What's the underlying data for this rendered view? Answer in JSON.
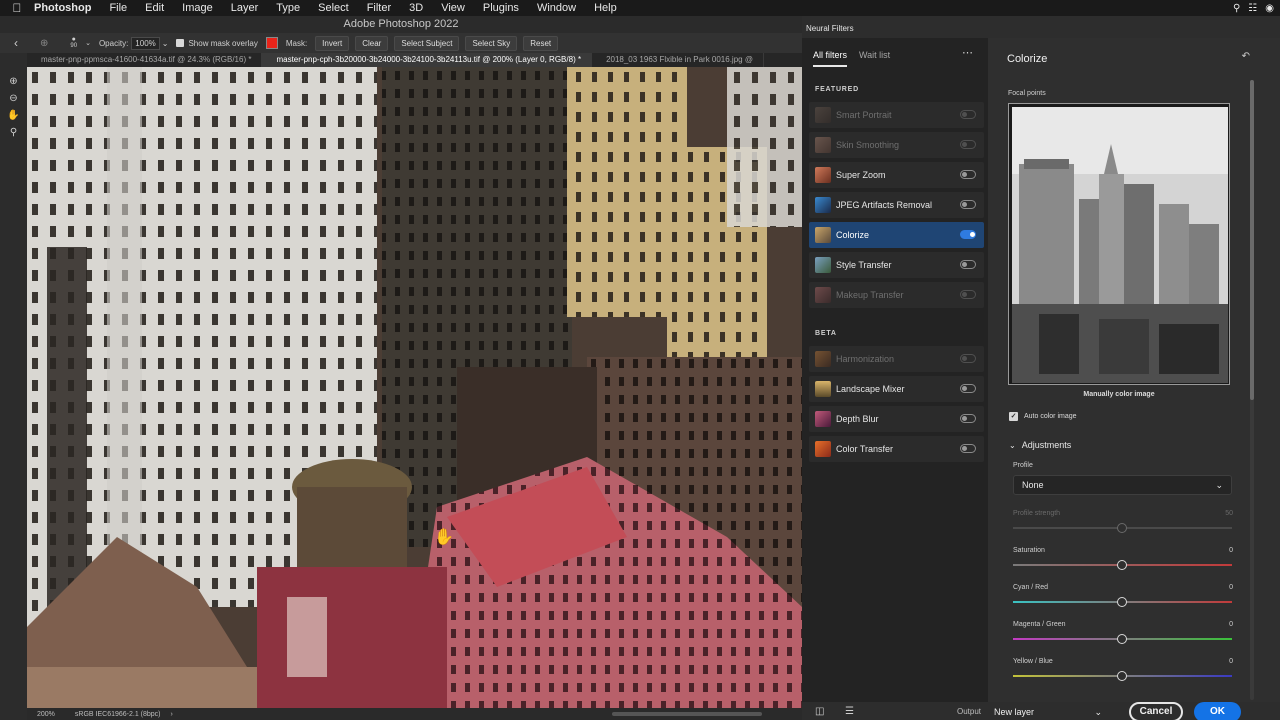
{
  "menubar": {
    "app": "Photoshop",
    "items": [
      "File",
      "Edit",
      "Image",
      "Layer",
      "Type",
      "Select",
      "Filter",
      "3D",
      "View",
      "Plugins",
      "Window",
      "Help"
    ]
  },
  "window": {
    "title": "Adobe Photoshop 2022"
  },
  "options_bar": {
    "brush_size": "90",
    "opacity_label": "Opacity:",
    "opacity_value": "100%",
    "show_mask_overlay": "Show mask overlay",
    "mask_label": "Mask:",
    "buttons": [
      "Invert",
      "Clear",
      "Select Subject",
      "Select Sky",
      "Reset"
    ],
    "mask_color": "#e8241a"
  },
  "doc_tabs": [
    "master-pnp-ppmsca-41600-41634a.tif @ 24.3% (RGB/16) *",
    "master-pnp-cph-3b20000-3b24000-3b24100-3b24113u.tif @ 200% (Layer 0, RGB/8) *",
    "2018_03 1963 Flxible in Park 0016.jpg @"
  ],
  "status_bar": {
    "zoom": "200%",
    "profile": "sRGB IEC61966-2.1 (8bpc)"
  },
  "neural_filters": {
    "panel_title": "Neural Filters",
    "tabs": [
      "All filters",
      "Wait list"
    ],
    "sections": [
      {
        "title": "FEATURED",
        "items": [
          {
            "label": "Smart Portrait",
            "enabled": false,
            "dim": true
          },
          {
            "label": "Skin Smoothing",
            "enabled": false,
            "dim": true
          },
          {
            "label": "Super Zoom",
            "enabled": false,
            "dim": false
          },
          {
            "label": "JPEG Artifacts Removal",
            "enabled": false,
            "dim": false
          },
          {
            "label": "Colorize",
            "enabled": true,
            "dim": false,
            "selected": true
          },
          {
            "label": "Style Transfer",
            "enabled": false,
            "dim": false
          },
          {
            "label": "Makeup Transfer",
            "enabled": false,
            "dim": true
          }
        ]
      },
      {
        "title": "BETA",
        "items": [
          {
            "label": "Harmonization",
            "enabled": false,
            "dim": true
          },
          {
            "label": "Landscape Mixer",
            "enabled": false,
            "dim": false
          },
          {
            "label": "Depth Blur",
            "enabled": false,
            "dim": false
          },
          {
            "label": "Color Transfer",
            "enabled": false,
            "dim": false
          }
        ]
      }
    ],
    "settings": {
      "title": "Colorize",
      "focal_points_label": "Focal points",
      "preview_caption": "Manually color image",
      "auto_color_label": "Auto color image",
      "adjustments_label": "Adjustments",
      "profile_label": "Profile",
      "profile_value": "None",
      "params": [
        {
          "label": "Profile strength",
          "value": "50",
          "dim": true
        },
        {
          "label": "Saturation",
          "value": "0",
          "dim": false
        },
        {
          "label": "Cyan / Red",
          "value": "0",
          "dim": false
        },
        {
          "label": "Magenta / Green",
          "value": "0",
          "dim": false
        },
        {
          "label": "Yellow / Blue",
          "value": "0",
          "dim": false
        }
      ]
    },
    "footer": {
      "output_label": "Output",
      "output_value": "New layer",
      "cancel_label": "Cancel",
      "ok_label": "OK"
    }
  }
}
